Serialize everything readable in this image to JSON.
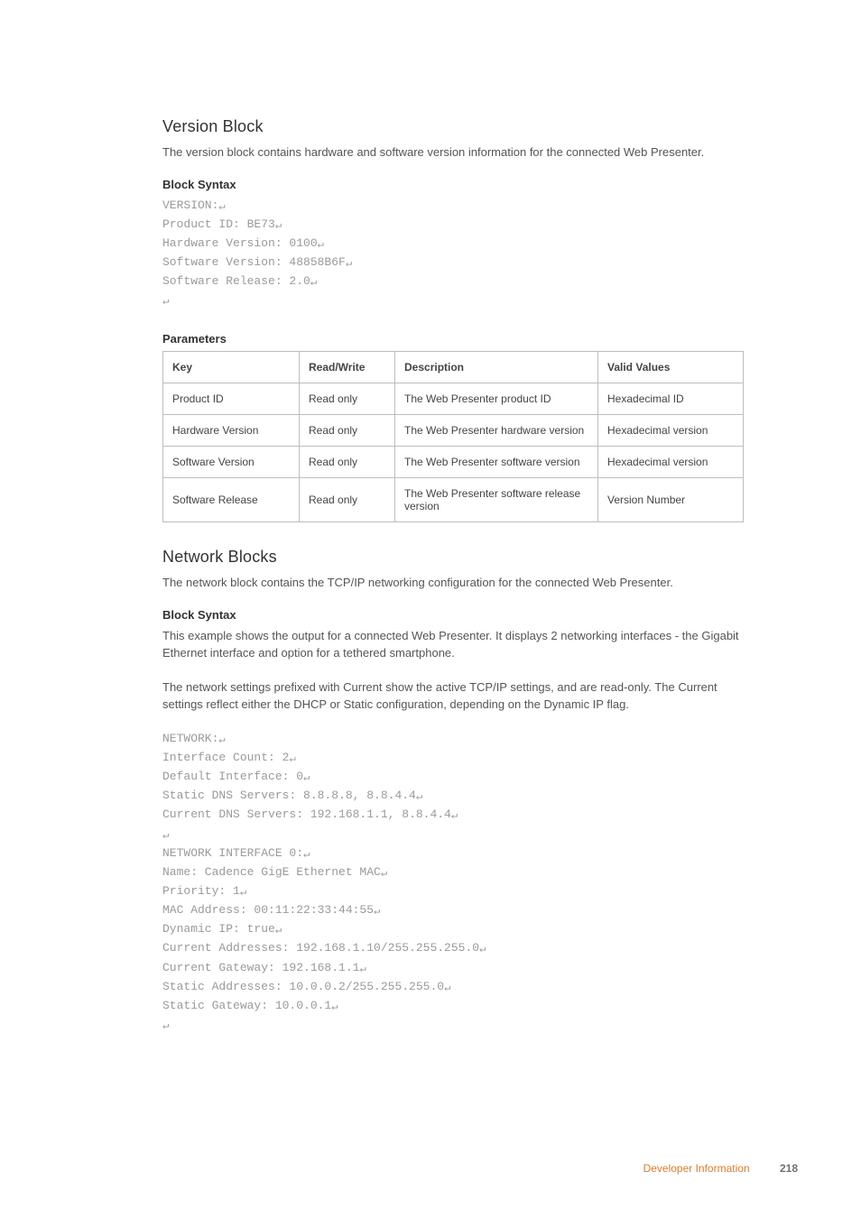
{
  "section1": {
    "heading": "Version Block",
    "intro": "The version block contains hardware and software version information for the connected Web Presenter.",
    "syntax_heading": "Block Syntax",
    "code_lines": [
      "VERSION:",
      "Product ID: BE73",
      "Hardware Version: 0100",
      "Software Version: 48858B6F",
      "Software Release: 2.0",
      ""
    ],
    "params_heading": "Parameters",
    "table": {
      "headers": [
        "Key",
        "Read/Write",
        "Description",
        "Valid Values"
      ],
      "rows": [
        [
          "Product ID",
          "Read only",
          "The Web Presenter product ID",
          "Hexadecimal ID"
        ],
        [
          "Hardware Version",
          "Read only",
          "The Web Presenter hardware version",
          "Hexadecimal version"
        ],
        [
          "Software Version",
          "Read only",
          "The Web Presenter software version",
          "Hexadecimal version"
        ],
        [
          "Software Release",
          "Read only",
          "The Web Presenter software release version",
          "Version Number"
        ]
      ]
    }
  },
  "section2": {
    "heading": "Network Blocks",
    "intro": "The network block contains the TCP/IP networking configuration for the connected Web Presenter.",
    "syntax_heading": "Block Syntax",
    "para1": "This example shows the output for a connected Web Presenter. It displays 2 networking interfaces - the Gigabit Ethernet interface and option for a tethered smartphone.",
    "para2": "The network settings prefixed with Current show the active TCP/IP settings, and are read-only. The Current settings reflect either the DHCP or Static configuration, depending on the Dynamic IP flag.",
    "code_lines": [
      "NETWORK:",
      "Interface Count: 2",
      "Default Interface: 0",
      "Static DNS Servers: 8.8.8.8, 8.8.4.4",
      "Current DNS Servers: 192.168.1.1, 8.8.4.4",
      "",
      "NETWORK INTERFACE 0:",
      "Name: Cadence GigE Ethernet MAC",
      "Priority: 1",
      "MAC Address: 00:11:22:33:44:55",
      "Dynamic IP: true",
      "Current Addresses: 192.168.1.10/255.255.255.0",
      "Current Gateway: 192.168.1.1",
      "Static Addresses: 10.0.0.2/255.255.255.0",
      "Static Gateway: 10.0.0.1",
      ""
    ]
  },
  "footer": {
    "title": "Developer Information",
    "page": "218"
  }
}
